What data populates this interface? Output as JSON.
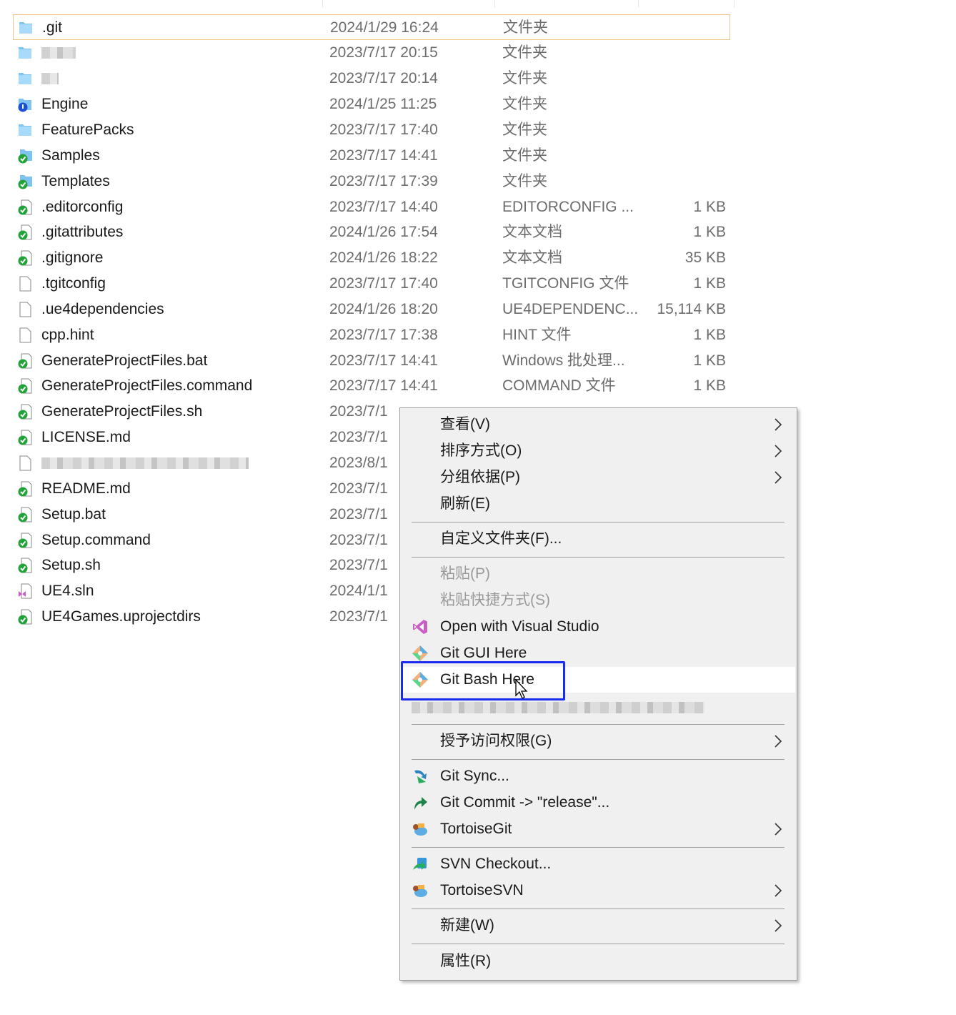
{
  "files": [
    {
      "name": ".git",
      "date": "2024/1/29 16:24",
      "type": "文件夹",
      "size": "",
      "icon": "folder-icon",
      "selected": true
    },
    {
      "name": "",
      "date": "2023/7/17 20:15",
      "type": "文件夹",
      "size": "",
      "icon": "folder-icon",
      "blurred": true
    },
    {
      "name": "",
      "date": "2023/7/17 20:14",
      "type": "文件夹",
      "size": "",
      "icon": "folder-icon",
      "blurred": true
    },
    {
      "name": "Engine",
      "date": "2024/1/25 11:25",
      "type": "文件夹",
      "size": "",
      "icon": "folder-modified-icon"
    },
    {
      "name": "FeaturePacks",
      "date": "2023/7/17 17:40",
      "type": "文件夹",
      "size": "",
      "icon": "folder-icon"
    },
    {
      "name": "Samples",
      "date": "2023/7/17 14:41",
      "type": "文件夹",
      "size": "",
      "icon": "folder-ok-icon"
    },
    {
      "name": "Templates",
      "date": "2023/7/17 17:39",
      "type": "文件夹",
      "size": "",
      "icon": "folder-ok-icon"
    },
    {
      "name": ".editorconfig",
      "date": "2023/7/17 14:40",
      "type": "EDITORCONFIG ...",
      "size": "1 KB",
      "icon": "file-ok-icon"
    },
    {
      "name": ".gitattributes",
      "date": "2024/1/26 17:54",
      "type": "文本文档",
      "size": "1 KB",
      "icon": "file-ok-icon"
    },
    {
      "name": ".gitignore",
      "date": "2024/1/26 18:22",
      "type": "文本文档",
      "size": "35 KB",
      "icon": "file-ok-icon"
    },
    {
      "name": ".tgitconfig",
      "date": "2023/7/17 17:40",
      "type": "TGITCONFIG 文件",
      "size": "1 KB",
      "icon": "file-icon"
    },
    {
      "name": ".ue4dependencies",
      "date": "2024/1/26 18:20",
      "type": "UE4DEPENDENC...",
      "size": "15,114 KB",
      "icon": "file-icon"
    },
    {
      "name": "cpp.hint",
      "date": "2023/7/17 17:38",
      "type": "HINT 文件",
      "size": "1 KB",
      "icon": "file-icon"
    },
    {
      "name": "GenerateProjectFiles.bat",
      "date": "2023/7/17 14:41",
      "type": "Windows 批处理...",
      "size": "1 KB",
      "icon": "file-ok-icon"
    },
    {
      "name": "GenerateProjectFiles.command",
      "date": "2023/7/17 14:41",
      "type": "COMMAND 文件",
      "size": "1 KB",
      "icon": "file-ok-icon"
    },
    {
      "name": "GenerateProjectFiles.sh",
      "date": "2023/7/1",
      "type": "",
      "size": "",
      "icon": "file-ok-icon"
    },
    {
      "name": "LICENSE.md",
      "date": "2023/7/1",
      "type": "",
      "size": "",
      "icon": "file-ok-icon"
    },
    {
      "name": "",
      "date": "2023/8/1",
      "type": "",
      "size": "",
      "icon": "file-icon",
      "blurred": true
    },
    {
      "name": "README.md",
      "date": "2023/7/1",
      "type": "",
      "size": "",
      "icon": "file-ok-icon"
    },
    {
      "name": "Setup.bat",
      "date": "2023/7/1",
      "type": "",
      "size": "",
      "icon": "file-ok-icon"
    },
    {
      "name": "Setup.command",
      "date": "2023/7/1",
      "type": "",
      "size": "",
      "icon": "file-ok-icon"
    },
    {
      "name": "Setup.sh",
      "date": "2023/7/1",
      "type": "",
      "size": "",
      "icon": "file-ok-icon"
    },
    {
      "name": "UE4.sln",
      "date": "2024/1/1",
      "type": "",
      "size": "",
      "icon": "sln-icon"
    },
    {
      "name": "UE4Games.uprojectdirs",
      "date": "2023/7/1",
      "type": "",
      "size": "",
      "icon": "file-ok-icon"
    }
  ],
  "menu": {
    "view": "查看(V)",
    "sort": "排序方式(O)",
    "group": "分组依据(P)",
    "refresh": "刷新(E)",
    "customize": "自定义文件夹(F)...",
    "paste": "粘贴(P)",
    "paste_shortcut": "粘贴快捷方式(S)",
    "open_vs": "Open with Visual Studio",
    "git_gui": "Git GUI Here",
    "git_bash": "Git Bash Here",
    "grant_access": "授予访问权限(G)",
    "git_sync": "Git Sync...",
    "git_commit": "Git Commit -> \"release\"...",
    "tortoise_git": "TortoiseGit",
    "svn_checkout": "SVN Checkout...",
    "tortoise_svn": "TortoiseSVN",
    "new": "新建(W)",
    "properties": "属性(R)"
  },
  "colors": {
    "highlight_box": "#1a2bf0",
    "selected_border": "#f0c48a",
    "menu_bg": "#f0f0f0"
  }
}
